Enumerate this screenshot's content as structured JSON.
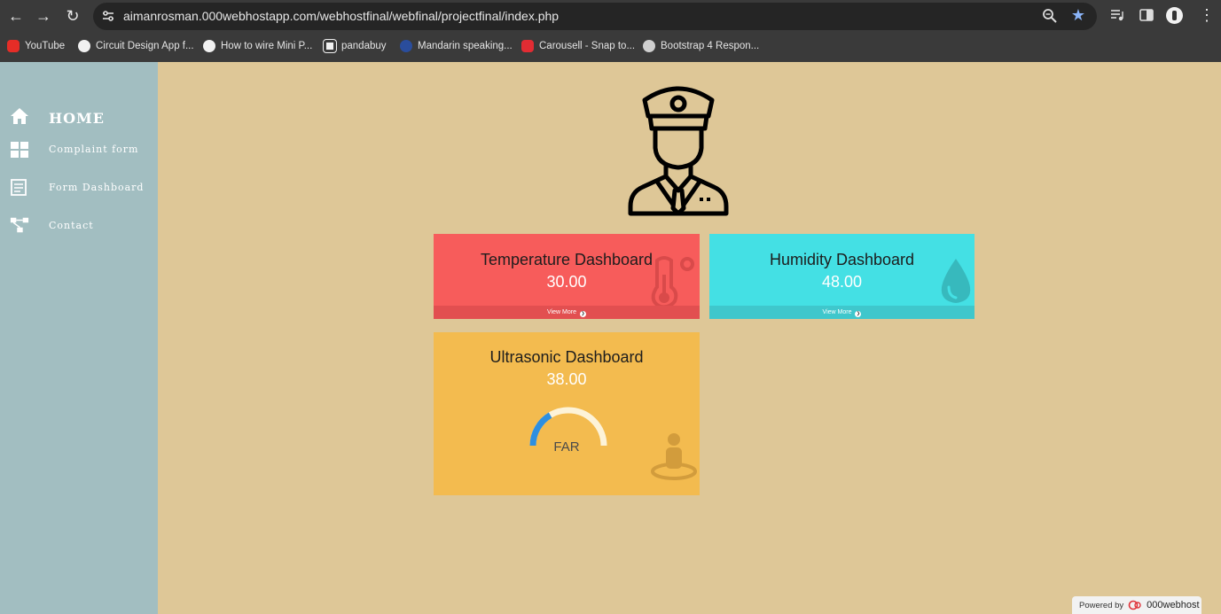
{
  "browser": {
    "url": "aimanrosman.000webhostapp.com/webhostfinal/webfinal/projectfinal/index.php",
    "bookmarks": [
      {
        "label": "YouTube",
        "icon": "youtube-icon"
      },
      {
        "label": "Circuit Design App f...",
        "icon": "globe-c-icon"
      },
      {
        "label": "How to wire Mini P...",
        "icon": "globe-c-icon"
      },
      {
        "label": "pandabuy",
        "icon": "pandabuy-icon"
      },
      {
        "label": "Mandarin speaking...",
        "icon": "arrow-icon"
      },
      {
        "label": "Carousell - Snap to...",
        "icon": "carousell-icon"
      },
      {
        "label": "Bootstrap 4 Respon...",
        "icon": "globe-icon"
      }
    ]
  },
  "sidebar": {
    "items": [
      {
        "label": "HOME",
        "icon": "home-icon"
      },
      {
        "label": "Complaint form",
        "icon": "grid-icon"
      },
      {
        "label": "Form Dashboard",
        "icon": "form-list-icon"
      },
      {
        "label": "Contact",
        "icon": "network-icon"
      }
    ]
  },
  "cards": {
    "temperature": {
      "title": "Temperature Dashboard",
      "value": "30.00",
      "footer": "View More",
      "color": "#f75c5b"
    },
    "humidity": {
      "title": "Humidity Dashboard",
      "value": "48.00",
      "footer": "View More",
      "color": "#44e0e4"
    },
    "ultrasonic": {
      "title": "Ultrasonic Dashboard",
      "value": "38.00",
      "gauge_label": "FAR",
      "gauge_fraction": 0.33,
      "color": "#f3bb4f"
    }
  },
  "footer": {
    "powered_by": "Powered by",
    "brand": "000webhost"
  },
  "colors": {
    "page_bg": "#dec797",
    "sidebar_bg": "#a2bec1",
    "gauge_fill": "#2d8fe0",
    "gauge_track": "#fdf3d8"
  }
}
